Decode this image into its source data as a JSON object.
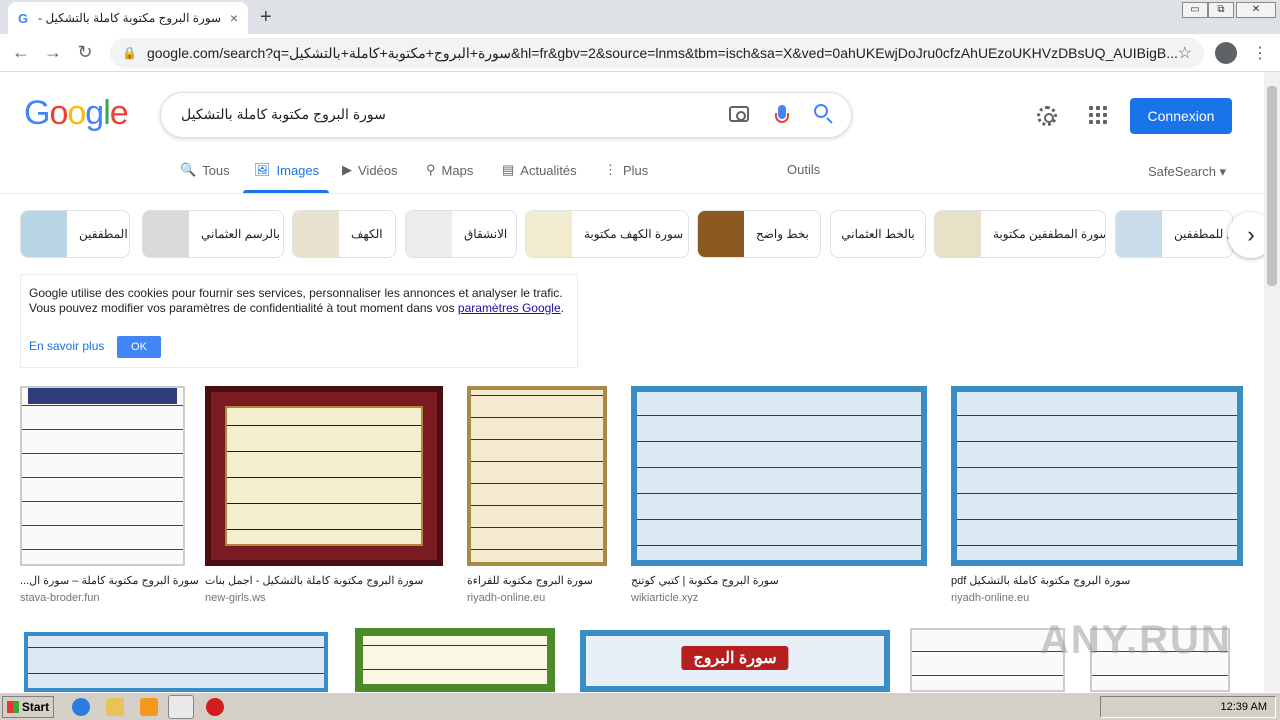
{
  "browser": {
    "tab_title": "سورة البروج مكتوبة كاملة بالتشكيل -",
    "tab_close": "×",
    "new_tab": "+",
    "url": "google.com/search?q=سورة+البروج+مكتوبة+كاملة+بالتشكيل&hl=fr&gbv=2&source=lnms&tbm=isch&sa=X&ved=0ahUKEwjDoJru0cfzAhUEzoUKHVzDBsUQ_AUIBigB...",
    "back": "←",
    "forward": "→",
    "reload": "↻",
    "lock": "🔒",
    "star": "☆",
    "menu": "⋮",
    "win_minimize": "▭",
    "win_restore": "⧉",
    "win_close": "✕"
  },
  "logo": [
    "G",
    "o",
    "o",
    "g",
    "l",
    "e"
  ],
  "logo_colors": [
    "#4285f4",
    "#ea4335",
    "#fbbc05",
    "#4285f4",
    "#34a853",
    "#ea4335"
  ],
  "search": {
    "query": "سورة البروج مكتوبة كاملة بالتشكيل"
  },
  "header": {
    "login": "Connexion"
  },
  "tabs": [
    {
      "label": "Tous",
      "icon": "🔍"
    },
    {
      "label": "Images",
      "icon": "🖼"
    },
    {
      "label": "Vidéos",
      "icon": "▶"
    },
    {
      "label": "Maps",
      "icon": "⚲"
    },
    {
      "label": "Actualités",
      "icon": "▤"
    },
    {
      "label": "Plus",
      "icon": "⋮"
    }
  ],
  "tools": "Outils",
  "safesearch": "SafeSearch ▾",
  "chips": [
    {
      "label": "المطففين",
      "thumb": "#b9d6e6"
    },
    {
      "label": "بالرسم العثماني",
      "thumb": "#d9d9d9"
    },
    {
      "label": "الكهف",
      "thumb": "#e9e2cf"
    },
    {
      "label": "الانشقاق",
      "thumb": "#ececec"
    },
    {
      "label": "سورة الكهف مكتوبة",
      "thumb": "#f2ecd0"
    },
    {
      "label": "بخط واضح",
      "thumb": "#8a5a20"
    },
    {
      "label": "بالخط العثماني",
      "thumb": ""
    },
    {
      "label": "سورة المطففين مكتوبة",
      "thumb": "#e7e1c7"
    },
    {
      "label": "ل للمطففين",
      "thumb": "#c9dcea"
    }
  ],
  "chip_next": "›",
  "cookie": {
    "text": "Google utilise des cookies pour fournir ses services, personnaliser les annonces et analyser le trafic. Vous pouvez modifier vos paramètres de confidentialité à tout moment dans vos",
    "link": "paramètres Google",
    "after": ".",
    "learn_more": "En savoir plus",
    "ok": "OK"
  },
  "results": [
    {
      "caption": "سورة البروج مكتوبة كاملة – سورة ال...",
      "source": "stava-broder.fun"
    },
    {
      "caption": "سورة البروج مكتوبة كاملة بالتشكيل - اجمل بنات",
      "source": "new-girls.ws"
    },
    {
      "caption": "سورة البروج مكتوبة للقراءة",
      "source": "riyadh-online.eu"
    },
    {
      "caption": "سورة البروج مكتوبة | كتبي كوتنج",
      "source": "wikiarticle.xyz"
    },
    {
      "caption": "سورة البروج مكتوبة كاملة بالتشكيل pdf",
      "source": "riyadh-online.eu"
    }
  ],
  "row2": {
    "sura_title": "سورة البروج"
  },
  "watermark": "ANY.RUN",
  "taskbar": {
    "start": "Start",
    "time": "12:39 AM"
  }
}
